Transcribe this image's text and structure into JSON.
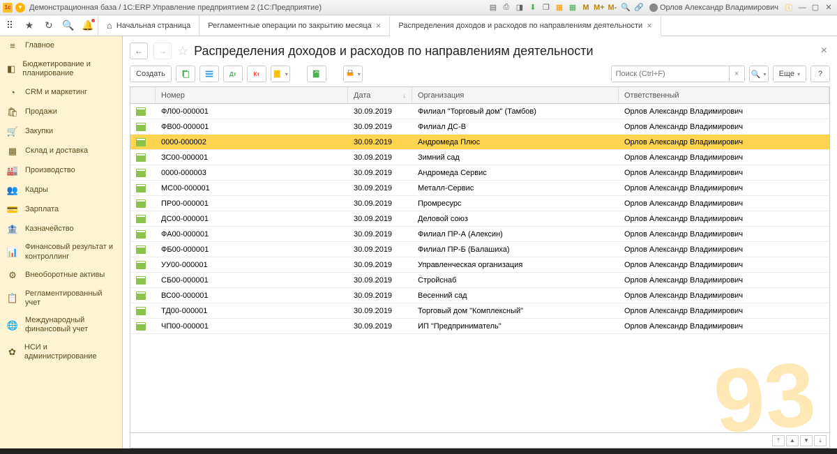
{
  "window": {
    "app_icon_text": "1c",
    "title": "Демонстрационная база / 1С:ERP Управление предприятием 2  (1С:Предприятие)",
    "user": "Орлов Александр Владимирович",
    "m_plus": "M+",
    "m_minus": "M-",
    "m": "M"
  },
  "tabs": {
    "home": "Начальная страница",
    "t1": "Регламентные операции по закрытию месяца",
    "t2": "Распределения доходов и расходов по направлениям деятельности"
  },
  "sidebar": {
    "items": [
      {
        "icon": "≡",
        "label": "Главное"
      },
      {
        "icon": "◧",
        "label": "Бюджетирование и планирование"
      },
      {
        "icon": "◔",
        "label": "CRM и маркетинг"
      },
      {
        "icon": "🛍",
        "label": "Продажи"
      },
      {
        "icon": "🛒",
        "label": "Закупки"
      },
      {
        "icon": "▦",
        "label": "Склад и доставка"
      },
      {
        "icon": "🏭",
        "label": "Производство"
      },
      {
        "icon": "👥",
        "label": "Кадры"
      },
      {
        "icon": "💳",
        "label": "Зарплата"
      },
      {
        "icon": "🏦",
        "label": "Казначейство"
      },
      {
        "icon": "📊",
        "label": "Финансовый результат и контроллинг"
      },
      {
        "icon": "⚙",
        "label": "Внеоборотные активы"
      },
      {
        "icon": "📋",
        "label": "Регламентированный учет"
      },
      {
        "icon": "🌐",
        "label": "Международный финансовый учет"
      },
      {
        "icon": "✿",
        "label": "НСИ и администрирование"
      }
    ]
  },
  "page": {
    "title": "Распределения доходов и расходов по направлениям деятельности",
    "create_btn": "Создать",
    "more_btn": "Еще",
    "search_placeholder": "Поиск (Ctrl+F)"
  },
  "columns": {
    "number": "Номер",
    "date": "Дата",
    "org": "Организация",
    "resp": "Ответственный"
  },
  "rows": [
    {
      "num": "ФЛ00-000001",
      "date": "30.09.2019",
      "org": "Филиал \"Торговый дом\" (Тамбов)",
      "resp": "Орлов Александр Владимирович"
    },
    {
      "num": "ФВ00-000001",
      "date": "30.09.2019",
      "org": "Филиал ДС-В",
      "resp": "Орлов Александр Владимирович"
    },
    {
      "num": "0000-000002",
      "date": "30.09.2019",
      "org": "Андромеда Плюс",
      "resp": "Орлов Александр Владимирович",
      "sel": true
    },
    {
      "num": "ЗС00-000001",
      "date": "30.09.2019",
      "org": "Зимний сад",
      "resp": "Орлов Александр Владимирович"
    },
    {
      "num": "0000-000003",
      "date": "30.09.2019",
      "org": "Андромеда Сервис",
      "resp": "Орлов Александр Владимирович"
    },
    {
      "num": "МС00-000001",
      "date": "30.09.2019",
      "org": "Металл-Сервис",
      "resp": "Орлов Александр Владимирович"
    },
    {
      "num": "ПР00-000001",
      "date": "30.09.2019",
      "org": "Промресурс",
      "resp": "Орлов Александр Владимирович"
    },
    {
      "num": "ДС00-000001",
      "date": "30.09.2019",
      "org": "Деловой союз",
      "resp": "Орлов Александр Владимирович"
    },
    {
      "num": "ФА00-000001",
      "date": "30.09.2019",
      "org": "Филиал ПР-А (Алексин)",
      "resp": "Орлов Александр Владимирович"
    },
    {
      "num": "ФБ00-000001",
      "date": "30.09.2019",
      "org": "Филиал ПР-Б (Балашиха)",
      "resp": "Орлов Александр Владимирович"
    },
    {
      "num": "УУ00-000001",
      "date": "30.09.2019",
      "org": "Управленческая организация",
      "resp": "Орлов Александр Владимирович"
    },
    {
      "num": "СБ00-000001",
      "date": "30.09.2019",
      "org": "Стройснаб",
      "resp": "Орлов Александр Владимирович"
    },
    {
      "num": "ВС00-000001",
      "date": "30.09.2019",
      "org": "Весенний сад",
      "resp": "Орлов Александр Владимирович"
    },
    {
      "num": "ТД00-000001",
      "date": "30.09.2019",
      "org": "Торговый дом \"Комплексный\"",
      "resp": "Орлов Александр Владимирович"
    },
    {
      "num": "ЧП00-000001",
      "date": "30.09.2019",
      "org": "ИП \"Предприниматель\"",
      "resp": "Орлов Александр Владимирович"
    }
  ]
}
